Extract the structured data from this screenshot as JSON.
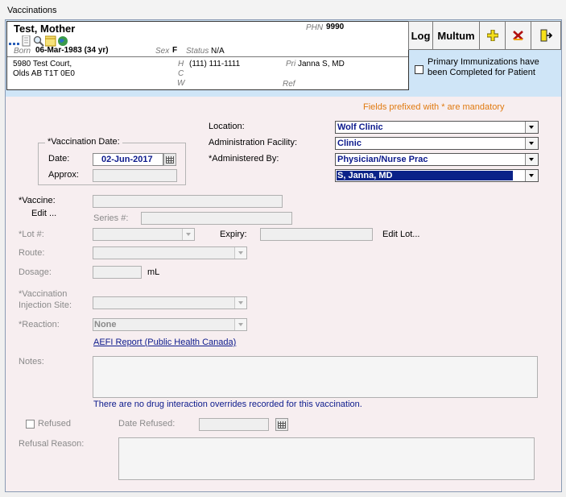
{
  "window": {
    "title": "Vaccinations"
  },
  "patient": {
    "name": "Test, Mother",
    "phn_label": "PHN",
    "phn_value": "9990",
    "born_label": "Born",
    "born_value": "06-Mar-1983 (34 yr)",
    "sex_label": "Sex",
    "sex_value": "F",
    "status_label": "Status",
    "status_value": "N/A",
    "address_line1": "5980 Test Court,",
    "address_line2": "Olds AB  T1T 0E0",
    "phone_h_label": "H",
    "phone_h_value": "(111) 111-1111",
    "phone_c_label": "C",
    "phone_w_label": "W",
    "pri_label": "Pri",
    "pri_value": "Janna S, MD",
    "ref_label": "Ref"
  },
  "toolbar": {
    "log_label": "Log",
    "multum_label": "Multum"
  },
  "immunization": {
    "completed_label": "Primary Immunizations have been Completed for Patient"
  },
  "form": {
    "mandatory_note": "Fields prefixed with * are mandatory",
    "vaccination_date_group": "*Vaccination Date:",
    "date_label": "Date:",
    "date_value": "02-Jun-2017",
    "approx_label": "Approx:",
    "location_label": "Location:",
    "location_value": "Wolf Clinic",
    "facility_label": "Administration Facility:",
    "facility_value": "Clinic",
    "administered_by_label": "*Administered By:",
    "administered_by_value": "Physician/Nurse Prac",
    "provider_value": "S, Janna, MD",
    "vaccine_label": "*Vaccine:",
    "edit_label": "Edit ...",
    "series_label": "Series #:",
    "lot_label": "*Lot #:",
    "expiry_label": "Expiry:",
    "edit_lot_label": "Edit Lot...",
    "route_label": "Route:",
    "dosage_label": "Dosage:",
    "dosage_unit": "mL",
    "injection_site_label_1": "*Vaccination",
    "injection_site_label_2": "Injection Site:",
    "reaction_label": "*Reaction:",
    "reaction_value": "None",
    "aefi_link": "AEFI Report (Public Health Canada)",
    "notes_label": "Notes:",
    "drug_interaction_note": "There are no drug interaction overrides recorded for this vaccination.",
    "refused_label": "Refused",
    "date_refused_label": "Date Refused:",
    "refusal_reason_label": "Refusal Reason:"
  },
  "colors": {
    "header_band": "#cfe5f7",
    "form_bg": "#f7eef0",
    "selected_blue": "#0c1a8c",
    "mandatory_orange": "#e07a10",
    "link_navy": "#0c1a8c"
  }
}
